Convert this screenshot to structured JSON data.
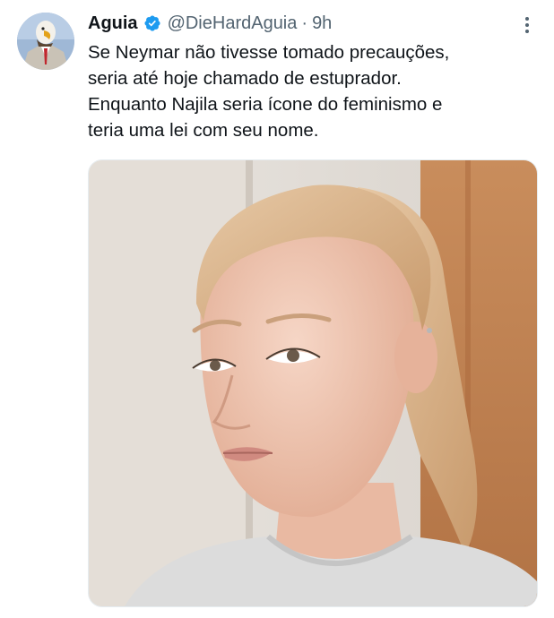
{
  "tweet": {
    "author": {
      "display_name": "Aguia",
      "verified": true,
      "handle": "@DieHardAguia",
      "separator": "·",
      "time": "9h"
    },
    "text_lines": [
      "Se Neymar não tivesse tomado precauções,",
      "seria até hoje chamado de estuprador.",
      "Enquanto Najila seria ícone do feminismo e",
      "teria uma lei com seu nome."
    ],
    "icons": {
      "avatar": "eagle-in-suit-avatar",
      "verified": "verified-badge-icon",
      "more": "more-options-icon",
      "media": "photo-of-woman-with-ponytail"
    },
    "colors": {
      "primary_text": "#0f1419",
      "secondary_text": "#536471",
      "verified_blue": "#1d9bf0"
    }
  }
}
